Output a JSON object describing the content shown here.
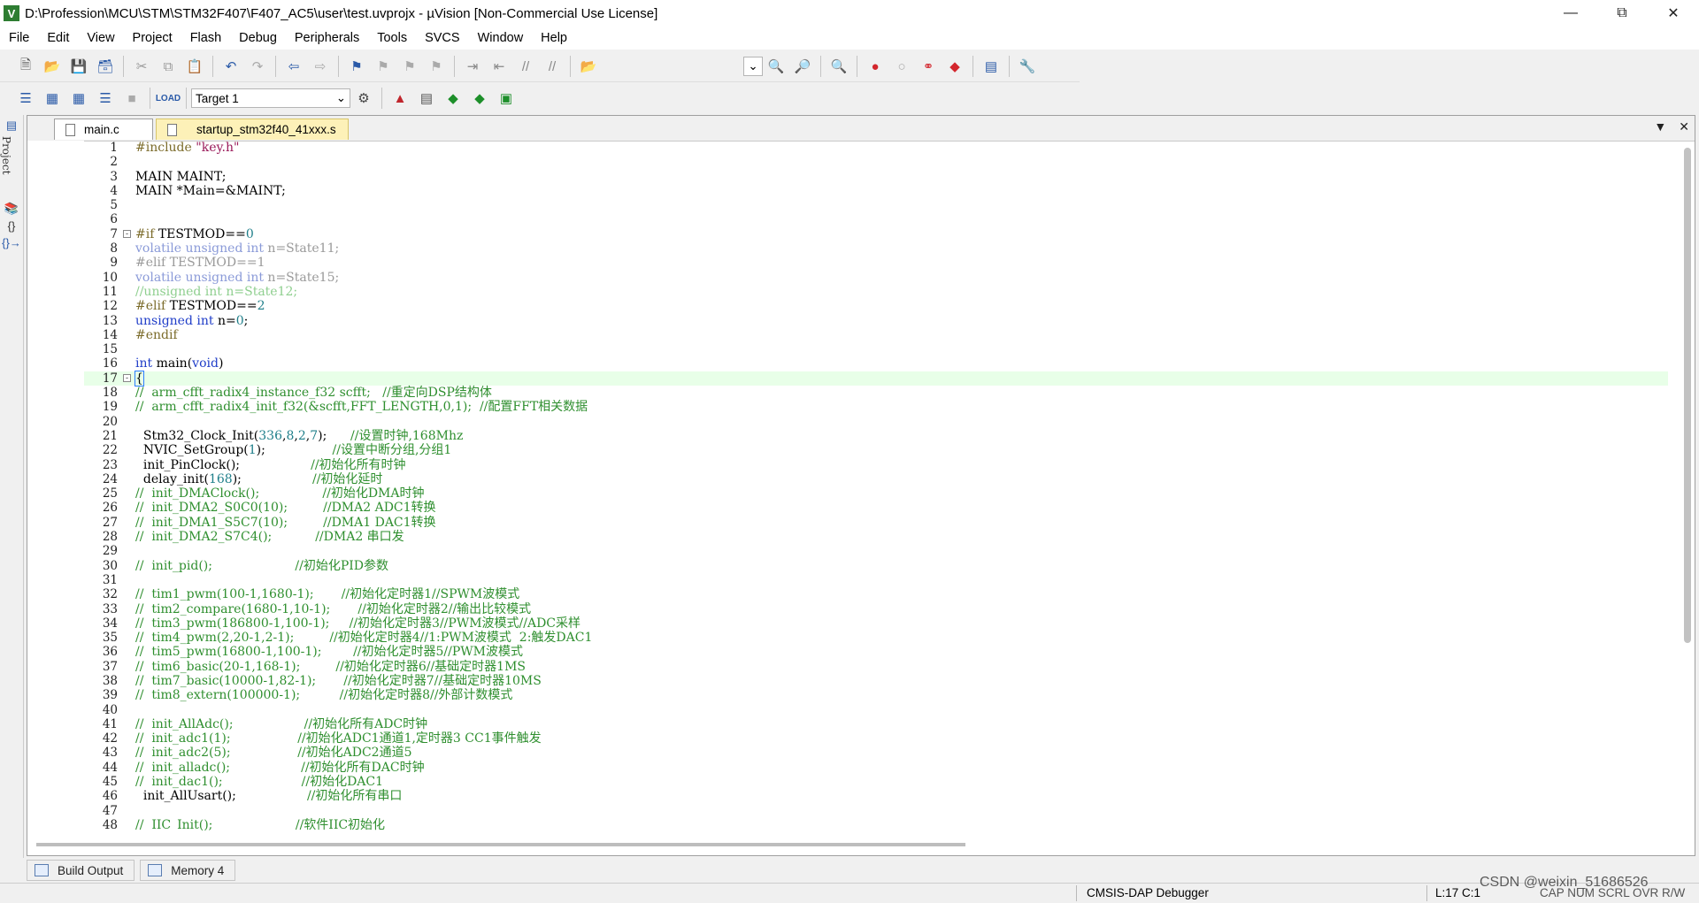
{
  "window": {
    "title": "D:\\Profession\\MCU\\STM\\STM32F407\\F407_AC5\\user\\test.uvprojx - µVision  [Non-Commercial Use License]",
    "app_icon_letter": "V"
  },
  "menu": [
    "File",
    "Edit",
    "View",
    "Project",
    "Flash",
    "Debug",
    "Peripherals",
    "Tools",
    "SVCS",
    "Window",
    "Help"
  ],
  "toolbar2": {
    "target_label": "Target 1"
  },
  "left_strip": {
    "project_label": "Project"
  },
  "tabs": [
    {
      "label": "main.c",
      "active": true
    },
    {
      "label": "startup_stm32f40_41xxx.s",
      "active": false
    }
  ],
  "code_lines": [
    {
      "n": "1",
      "t": "#include \"key.h\""
    },
    {
      "n": "2",
      "t": ""
    },
    {
      "n": "3",
      "t": "MAIN MAINT;"
    },
    {
      "n": "4",
      "t": "MAIN *Main=&MAINT;"
    },
    {
      "n": "5",
      "t": ""
    },
    {
      "n": "6",
      "t": ""
    },
    {
      "n": "7",
      "t": "#if TESTMOD==0",
      "fold": "-"
    },
    {
      "n": "8",
      "t": "volatile unsigned int n=State11;"
    },
    {
      "n": "9",
      "t": "#elif TESTMOD==1"
    },
    {
      "n": "10",
      "t": "volatile unsigned int n=State15;"
    },
    {
      "n": "11",
      "t": "//unsigned int n=State12;"
    },
    {
      "n": "12",
      "t": "#elif TESTMOD==2"
    },
    {
      "n": "13",
      "t": "unsigned int n=0;"
    },
    {
      "n": "14",
      "t": "#endif"
    },
    {
      "n": "15",
      "t": ""
    },
    {
      "n": "16",
      "t": "int main(void)"
    },
    {
      "n": "17",
      "t": "{",
      "fold": "-",
      "hl": true
    },
    {
      "n": "18",
      "t": "//  arm_cfft_radix4_instance_f32 scfft;   //重定向DSP结构体"
    },
    {
      "n": "19",
      "t": "//  arm_cfft_radix4_init_f32(&scfft,FFT_LENGTH,0,1);  //配置FFT相关数据"
    },
    {
      "n": "20",
      "t": ""
    },
    {
      "n": "21",
      "t": "  Stm32_Clock_Init(336,8,2,7);      //设置时钟,168Mhz"
    },
    {
      "n": "22",
      "t": "  NVIC_SetGroup(1);                 //设置中断分组,分组1"
    },
    {
      "n": "23",
      "t": "  init_PinClock();                  //初始化所有时钟"
    },
    {
      "n": "24",
      "t": "  delay_init(168);                  //初始化延时"
    },
    {
      "n": "25",
      "t": "//  init_DMAClock();                //初始化DMA时钟"
    },
    {
      "n": "26",
      "t": "//  init_DMA2_S0C0(10);         //DMA2 ADC1转换"
    },
    {
      "n": "27",
      "t": "//  init_DMA1_S5C7(10);         //DMA1 DAC1转换"
    },
    {
      "n": "28",
      "t": "//  init_DMA2_S7C4();           //DMA2 串口发"
    },
    {
      "n": "29",
      "t": ""
    },
    {
      "n": "30",
      "t": "//  init_pid();                     //初始化PID参数"
    },
    {
      "n": "31",
      "t": ""
    },
    {
      "n": "32",
      "t": "//  tim1_pwm(100-1,1680-1);       //初始化定时器1//SPWM波模式"
    },
    {
      "n": "33",
      "t": "//  tim2_compare(1680-1,10-1);       //初始化定时器2//输出比较模式"
    },
    {
      "n": "34",
      "t": "//  tim3_pwm(186800-1,100-1);     //初始化定时器3//PWM波模式//ADC采样"
    },
    {
      "n": "35",
      "t": "//  tim4_pwm(2,20-1,2-1);         //初始化定时器4//1:PWM波模式  2:触发DAC1"
    },
    {
      "n": "36",
      "t": "//  tim5_pwm(16800-1,100-1);        //初始化定时器5//PWM波模式"
    },
    {
      "n": "37",
      "t": "//  tim6_basic(20-1,168-1);         //初始化定时器6//基础定时器1MS"
    },
    {
      "n": "38",
      "t": "//  tim7_basic(10000-1,82-1);       //初始化定时器7//基础定时器10MS"
    },
    {
      "n": "39",
      "t": "//  tim8_extern(100000-1);          //初始化定时器8//外部计数模式"
    },
    {
      "n": "40",
      "t": ""
    },
    {
      "n": "41",
      "t": "//  init_AllAdc();                  //初始化所有ADC时钟"
    },
    {
      "n": "42",
      "t": "//  init_adc1(1);                 //初始化ADC1通道1,定时器3 CC1事件触发"
    },
    {
      "n": "43",
      "t": "//  init_adc2(5);                 //初始化ADC2通道5"
    },
    {
      "n": "44",
      "t": "//  init_alladc();                  //初始化所有DAC时钟"
    },
    {
      "n": "45",
      "t": "//  init_dac1();                    //初始化DAC1"
    },
    {
      "n": "46",
      "t": "  init_AllUsart();                  //初始化所有串口"
    },
    {
      "n": "47",
      "t": ""
    },
    {
      "n": "48",
      "t": "//  IIC_Init();                     //软件IIC初始化"
    }
  ],
  "bottom_tabs": [
    "Build Output",
    "Memory 4"
  ],
  "status": {
    "debugger": "CMSIS-DAP Debugger",
    "position": "L:17 C:1",
    "watermark": "CSDN @weixin_51686526",
    "indicators": "CAP  NUM  SCRL  OVR  R/W"
  },
  "colors": {
    "keyword": "#1f3dc8",
    "comment": "#2f8f2f",
    "number": "#1f7f8a",
    "string": "#9a1a5a",
    "directive": "#7b6b2a",
    "highlight": "#e8ffe8"
  }
}
